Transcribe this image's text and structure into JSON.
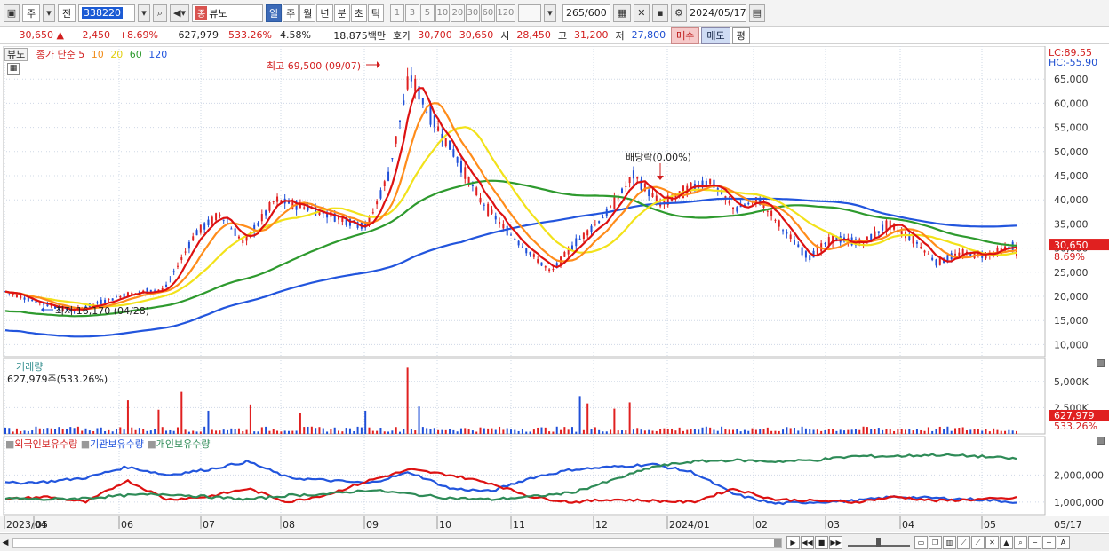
{
  "toolbar": {
    "period_main": "주",
    "prev_label": "전",
    "code": "338220",
    "stock_name": "뷰노",
    "period_tabs": [
      "일",
      "주",
      "월",
      "년",
      "분",
      "초",
      "틱"
    ],
    "interval_tabs": [
      "1",
      "3",
      "5",
      "10",
      "20",
      "30",
      "60",
      "120"
    ],
    "count": "265",
    "count_total": "/600",
    "date": "2024/05/17"
  },
  "quote": {
    "price": "30,650",
    "arrow": "▲",
    "change": "2,450",
    "change_pct": "+8.69%",
    "volume": "627,979",
    "volume_pct": "533.26%",
    "turnover_pct": "4.58%",
    "amount": "18,875백만",
    "ask_label": "호가",
    "ask1": "30,700",
    "ask2": "30,650",
    "open_label": "시",
    "open": "28,450",
    "high_label": "고",
    "high": "31,200",
    "low_label": "저",
    "low": "27,800",
    "buy_label": "매수",
    "sell_label": "매도",
    "p_label": "평"
  },
  "price_panel": {
    "legend_name": "뷰노",
    "legend_ma_label": "종가 단순 5",
    "legend_periods": [
      "10",
      "20",
      "60",
      "120"
    ],
    "lc": "LC:89.55",
    "hc": "HC:-55.90",
    "high_annotation": "최고 69,500 (09/07)",
    "low_annotation": "최저 16,170 (04/28)",
    "dividend_annotation": "배당락(0.00%)",
    "y_ticks": [
      "65,000",
      "60,000",
      "55,000",
      "50,000",
      "45,000",
      "40,000",
      "35,000",
      "30,000",
      "25,000",
      "20,000",
      "15,000",
      "10,000"
    ],
    "last_price_tag": "30,650",
    "last_pct_tag": "8.69%"
  },
  "volume_panel": {
    "title": "거래량",
    "subtitle": "627,979주(533.26%)",
    "y_ticks": [
      "5,000K",
      "2,500K"
    ],
    "last_tag": "627,979",
    "last_pct_tag": "533.26%"
  },
  "holdings_panel": {
    "legend": [
      "외국인보유수량",
      "기관보유수량",
      "개인보유수량"
    ],
    "y_ticks": [
      "2,000,000",
      "1,000,000"
    ]
  },
  "x_axis": {
    "labels": [
      "2023/04",
      "05",
      "06",
      "07",
      "08",
      "09",
      "10",
      "11",
      "12",
      "2024/01",
      "02",
      "03",
      "04",
      "05"
    ],
    "end_label": "05/17"
  },
  "colors": {
    "ma5": "#dd1111",
    "ma10": "#ff8c1a",
    "ma20": "#f2e21a",
    "ma60": "#2e9a2e",
    "ma120": "#2255dd",
    "foreign": "#dd1111",
    "institution": "#2255dd",
    "individual": "#2e8b57"
  },
  "chart_data": {
    "type": "candlestick",
    "price_range": [
      7500,
      70000
    ],
    "price_series_monthly_close": [
      {
        "x": "2023/04",
        "y": 18000
      },
      {
        "x": "05",
        "y": 20000
      },
      {
        "x": "06",
        "y": 35000
      },
      {
        "x": "07",
        "y": 38000
      },
      {
        "x": "08",
        "y": 36000
      },
      {
        "x": "09",
        "y": 55000
      },
      {
        "x": "10",
        "y": 33000
      },
      {
        "x": "11",
        "y": 28000
      },
      {
        "x": "12",
        "y": 42000
      },
      {
        "x": "2024/01",
        "y": 40000
      },
      {
        "x": "02",
        "y": 30000
      },
      {
        "x": "03",
        "y": 32000
      },
      {
        "x": "04",
        "y": 29000
      },
      {
        "x": "05",
        "y": 30650
      }
    ],
    "annotations": [
      {
        "label": "최고",
        "value": 69500,
        "date": "09/07"
      },
      {
        "label": "최저",
        "value": 16170,
        "date": "04/28"
      }
    ]
  }
}
